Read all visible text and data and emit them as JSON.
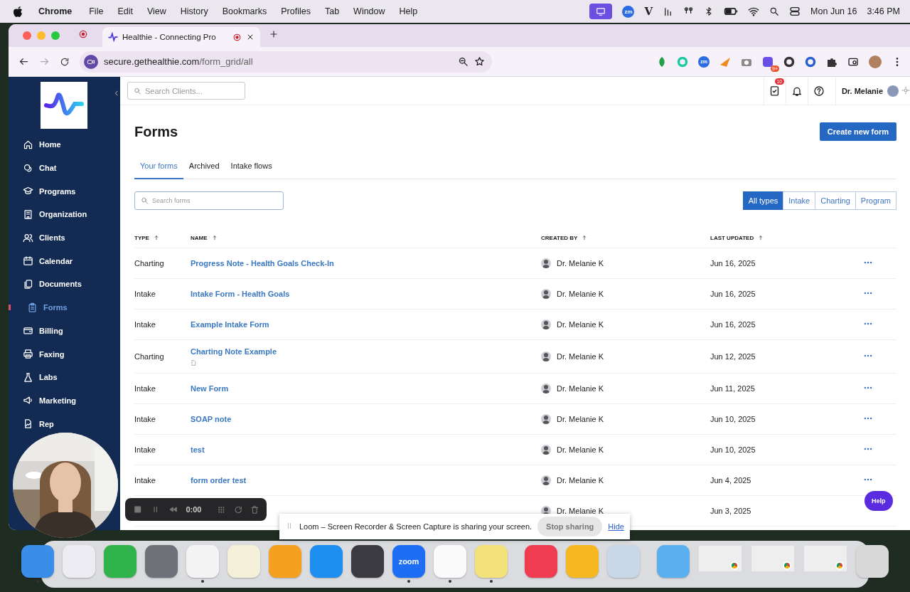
{
  "menu_bar": {
    "app": "Chrome",
    "menus": [
      "File",
      "Edit",
      "View",
      "History",
      "Bookmarks",
      "Profiles",
      "Tab",
      "Window",
      "Help"
    ],
    "status_icons": [
      {
        "kind": "screen"
      },
      {
        "kind": "badge",
        "label": "zm"
      },
      {
        "kind": "letter",
        "label": "V"
      },
      {
        "kind": "bars"
      },
      {
        "kind": "pods"
      },
      {
        "kind": "bluetooth"
      },
      {
        "kind": "battery"
      },
      {
        "kind": "wifi"
      },
      {
        "kind": "search"
      },
      {
        "kind": "control"
      }
    ],
    "date": "Mon Jun 16",
    "time": "3:46 PM"
  },
  "browser": {
    "tab": {
      "title": "Healthie - Connecting Pro"
    },
    "url": {
      "host": "secure.gethealthie.com",
      "path": "/form_grid/all"
    },
    "extensions": [
      {
        "kind": "leaf",
        "color": "#22a045"
      },
      {
        "kind": "ring",
        "color": "#1fc8a0"
      },
      {
        "kind": "badge",
        "label": "zm",
        "color": "#2d6be4"
      },
      {
        "kind": "plane",
        "color": "#f08a20"
      },
      {
        "kind": "camera",
        "color": "#8a8a8a"
      },
      {
        "kind": "app",
        "color": "#6a4ee8",
        "badge": "9+"
      },
      {
        "kind": "ring",
        "color": "#333333"
      },
      {
        "kind": "ring",
        "color": "#2a5fd0"
      },
      {
        "kind": "puzzle",
        "color": "#333333"
      }
    ]
  },
  "sidebar": {
    "items": [
      {
        "label": "Home",
        "selected": false
      },
      {
        "label": "Chat",
        "selected": false
      },
      {
        "label": "Programs",
        "selected": false
      },
      {
        "label": "Organization",
        "selected": false
      },
      {
        "label": "Clients",
        "selected": false
      },
      {
        "label": "Calendar",
        "selected": false
      },
      {
        "label": "Documents",
        "selected": false
      },
      {
        "label": "Forms",
        "selected": true
      },
      {
        "label": "Billing",
        "selected": false
      },
      {
        "label": "Faxing",
        "selected": false
      },
      {
        "label": "Labs",
        "selected": false
      },
      {
        "label": "Marketing",
        "selected": false
      },
      {
        "label": "Rep",
        "selected": false
      }
    ]
  },
  "top_bar": {
    "search": {
      "placeholder": "Search Clients..."
    },
    "task_count": "10",
    "user": "Dr. Melanie"
  },
  "page": {
    "title": "Forms",
    "create_button": "Create new form",
    "tabs": [
      {
        "label": "Your forms",
        "selected": true
      },
      {
        "label": "Archived",
        "selected": false
      },
      {
        "label": "Intake flows",
        "selected": false
      }
    ],
    "search": {
      "placeholder": "Search forms"
    },
    "type_filters": [
      {
        "label": "All types",
        "selected": true
      },
      {
        "label": "Intake",
        "selected": false
      },
      {
        "label": "Charting",
        "selected": false
      },
      {
        "label": "Program",
        "selected": false
      }
    ],
    "table": {
      "columns": [
        {
          "label": "TYPE"
        },
        {
          "label": "NAME"
        },
        {
          "label": "CREATED BY"
        },
        {
          "label": "LAST UPDATED"
        }
      ],
      "rows": [
        {
          "type": "Charting",
          "name": "Progress Note - Health Goals Check-In",
          "created_by": "Dr. Melanie K",
          "last_updated": "Jun 16, 2025",
          "attachment": false
        },
        {
          "type": "Intake",
          "name": "Intake Form - Health Goals",
          "created_by": "Dr. Melanie K",
          "last_updated": "Jun 16, 2025",
          "attachment": false
        },
        {
          "type": "Intake",
          "name": "Example Intake Form",
          "created_by": "Dr. Melanie K",
          "last_updated": "Jun 16, 2025",
          "attachment": false
        },
        {
          "type": "Charting",
          "name": "Charting Note Example",
          "created_by": "Dr. Melanie K",
          "last_updated": "Jun 12, 2025",
          "attachment": true
        },
        {
          "type": "Intake",
          "name": "New Form",
          "created_by": "Dr. Melanie K",
          "last_updated": "Jun 11, 2025",
          "attachment": false
        },
        {
          "type": "Intake",
          "name": "SOAP note",
          "created_by": "Dr. Melanie K",
          "last_updated": "Jun 10, 2025",
          "attachment": false
        },
        {
          "type": "Intake",
          "name": "test",
          "created_by": "Dr. Melanie K",
          "last_updated": "Jun 10, 2025",
          "attachment": false
        },
        {
          "type": "Intake",
          "name": "form order test",
          "created_by": "Dr. Melanie K",
          "last_updated": "Jun 4, 2025",
          "attachment": false
        },
        {
          "created_by": "Dr. Melanie K",
          "last_updated": "Jun 3, 2025"
        }
      ]
    }
  },
  "loom_controls": {
    "timer": "0:00"
  },
  "share_banner": {
    "message": "Loom – Screen Recorder & Screen Capture is sharing your screen.",
    "stop_button": "Stop sharing",
    "hide_link": "Hide"
  },
  "help_button": "Help",
  "dock": {
    "items": [
      {
        "kind": "app",
        "color": "#3a8ee8",
        "running": true
      },
      {
        "kind": "app",
        "color": "#ececf2",
        "running": false
      },
      {
        "kind": "app",
        "color": "#2fb34a",
        "running": false
      },
      {
        "kind": "app",
        "color": "#707078",
        "running": false
      },
      {
        "kind": "app",
        "color": "#f4f4f4",
        "running": true
      },
      {
        "kind": "app",
        "color": "#f4efd8",
        "running": false
      },
      {
        "kind": "app",
        "color": "#f6a020",
        "running": false
      },
      {
        "kind": "app",
        "color": "#1e8ef0",
        "running": false
      },
      {
        "kind": "app",
        "color": "#3a3a40",
        "running": false
      },
      {
        "kind": "app",
        "color": "#1d6ef5",
        "label": "zoom",
        "running": true
      },
      {
        "kind": "app",
        "color": "#fafafa",
        "running": true
      },
      {
        "kind": "app",
        "color": "#f3e27a",
        "running": true
      },
      {
        "kind": "separator"
      },
      {
        "kind": "app",
        "color": "#f03c50",
        "running": false
      },
      {
        "kind": "app",
        "color": "#f6b820",
        "running": false
      },
      {
        "kind": "app",
        "color": "#c8d8e8",
        "running": false
      },
      {
        "kind": "separator"
      },
      {
        "kind": "app",
        "color": "#5ab0ee",
        "running": false
      },
      {
        "kind": "window",
        "color": "#eeeeee"
      },
      {
        "kind": "window",
        "color": "#eeeeee"
      },
      {
        "kind": "window",
        "color": "#eeeeee"
      },
      {
        "kind": "app",
        "color": "#d8d8d8",
        "running": false
      }
    ]
  }
}
